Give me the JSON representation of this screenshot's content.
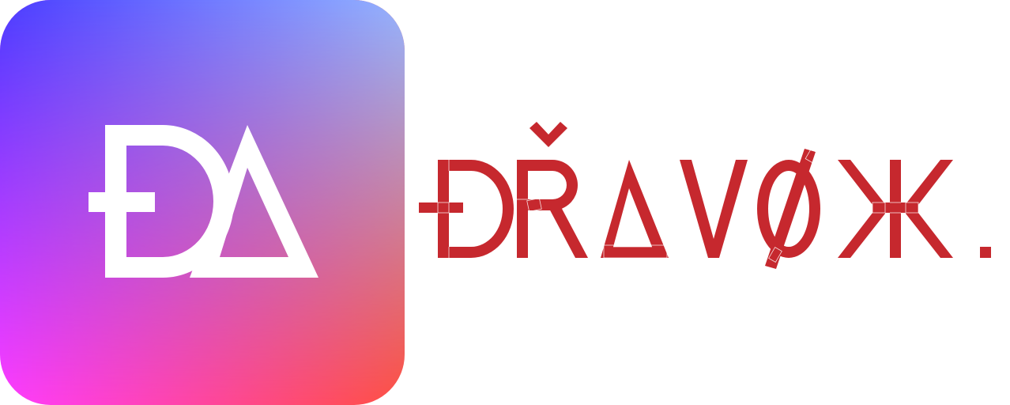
{
  "brand": {
    "monogram": "ĐΔ",
    "wordmark": "ĐŘΔVØЖ."
  },
  "colors": {
    "gradient_top_left": "#4a3dff",
    "gradient_top_right": "#94b4ff",
    "gradient_bottom_left": "#ff3cff",
    "gradient_bottom_right": "#ff5040",
    "monogram_fill": "#ffffff",
    "wordmark_fill": "#c6282e",
    "construction_lines": "#ffffff"
  },
  "icons": {
    "app_icon": "da-monogram-icon",
    "wordmark": "dravox-wordmark-logo"
  }
}
